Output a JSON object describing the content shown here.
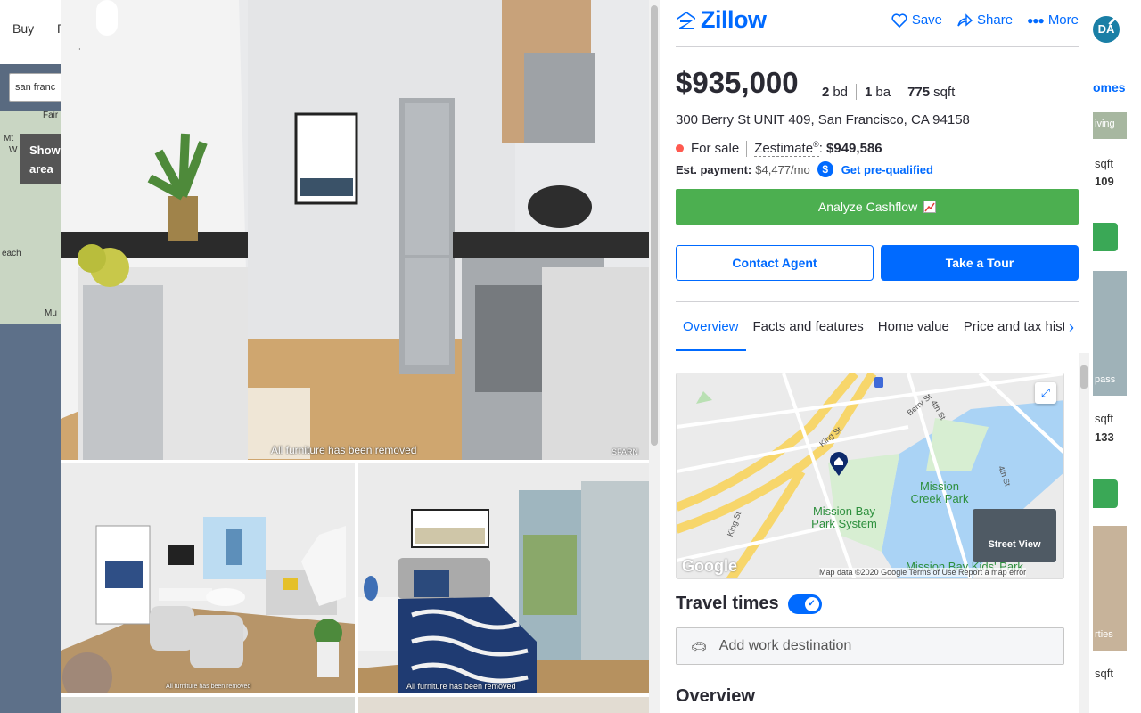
{
  "background": {
    "nav": [
      "Buy",
      "R"
    ],
    "search_value": "san franc",
    "map_labels": [
      "Fair",
      "Mt",
      "W",
      "each",
      "Mu"
    ],
    "show_area": [
      "Show",
      "area"
    ],
    "right_link": "omes",
    "right_cards": [
      "iving",
      "sqft",
      "109",
      "pass",
      "sqft",
      "133",
      "rties",
      "sqft"
    ],
    "avatar": "DA"
  },
  "gallery": {
    "captions": [
      "All furniture has been removed",
      "All furniture has been removed",
      "All furniture has been removed"
    ],
    "watermark": "SFARN"
  },
  "header": {
    "brand": "Zillow",
    "save": "Save",
    "share": "Share",
    "more": "More"
  },
  "listing": {
    "price": "$935,000",
    "beds": "2",
    "beds_unit": "bd",
    "baths": "1",
    "baths_unit": "ba",
    "sqft": "775",
    "sqft_unit": "sqft",
    "address": "300 Berry St UNIT 409, San Francisco, CA 94158",
    "status": "For sale",
    "zestimate_label": "Zestimate",
    "zestimate_value": "$949,586",
    "payment_label": "Est. payment:",
    "payment_value": "$4,477/mo",
    "prequal": "Get pre-qualified"
  },
  "buttons": {
    "cashflow": "Analyze Cashflow",
    "contact": "Contact Agent",
    "tour": "Take a Tour"
  },
  "tabs": [
    "Overview",
    "Facts and features",
    "Home value",
    "Price and tax history"
  ],
  "map": {
    "labels": [
      "Mission Bay Park System",
      "Mission Creek Park",
      "Mission Bay Kids' Park"
    ],
    "streets": [
      "King St",
      "4th St",
      "Berry St",
      "King St",
      "4th St"
    ],
    "street_view": "Street View",
    "google": "Google",
    "attribution": "Map data ©2020 Google   Terms of Use   Report a map error"
  },
  "travel": {
    "title": "Travel times",
    "placeholder": "Add work destination"
  },
  "overview_heading": "Overview",
  "colors": {
    "brand": "#006aff",
    "cashflow": "#4caf50",
    "status_dot": "#ff5a50"
  }
}
